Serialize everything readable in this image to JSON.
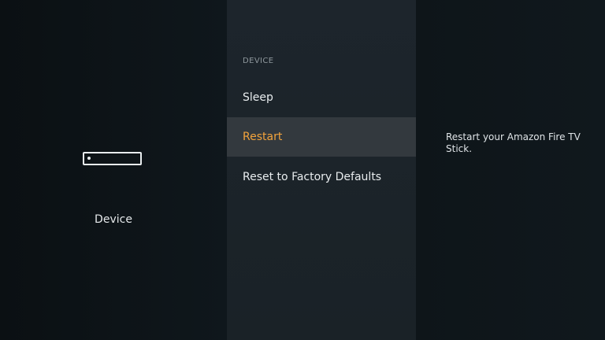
{
  "left_pane": {
    "icon": "device-icon",
    "label": "Device"
  },
  "menu": {
    "section_header": "DEVICE",
    "items": [
      {
        "label": "Sleep"
      },
      {
        "label": "Restart"
      },
      {
        "label": "Reset to Factory Defaults"
      }
    ],
    "selected_item": "Restart"
  },
  "description": {
    "text": "Restart your Amazon Fire TV Stick."
  },
  "colors": {
    "selected_text": "#f2a33c",
    "selected_background": "#33393e",
    "text": "#e8ecee"
  }
}
